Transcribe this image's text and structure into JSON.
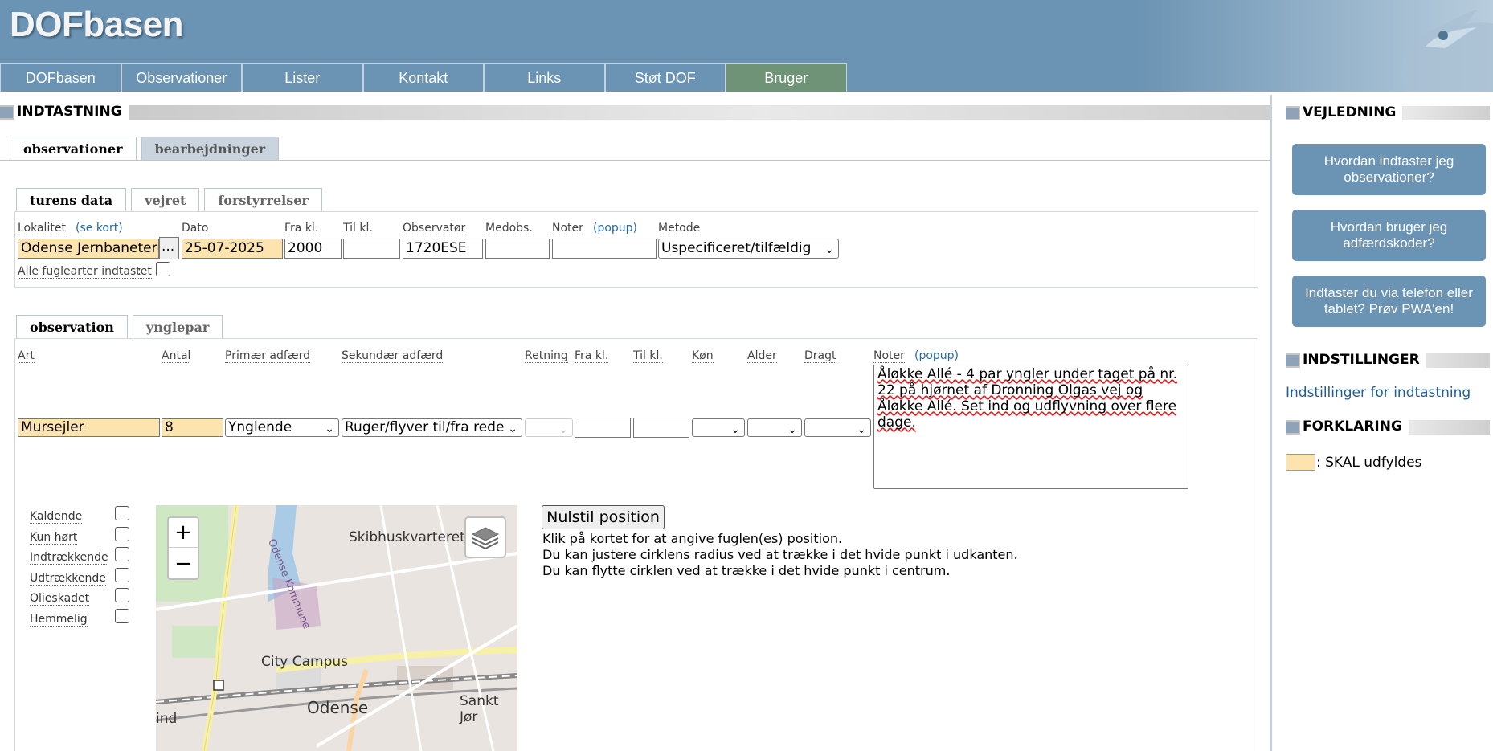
{
  "app": {
    "logo": "DOFbasen"
  },
  "nav": [
    "DOFbasen",
    "Observationer",
    "Lister",
    "Kontakt",
    "Links",
    "Støt DOF",
    "Bruger"
  ],
  "main": {
    "title": "INDTASTNING",
    "tabs": [
      "observationer",
      "bearbejdninger"
    ],
    "trip_tabs": [
      "turens data",
      "vejret",
      "forstyrrelser"
    ],
    "trip": {
      "lokalitet_label": "Lokalitet",
      "lokalitet_link": "(se kort)",
      "lokalitet_value": "Odense Jernbaneterr",
      "dots": "...",
      "dato_label": "Dato",
      "dato_value": "25-07-2025",
      "fra_label": "Fra kl.",
      "fra_value": "2000",
      "til_label": "Til kl.",
      "til_value": "",
      "obs_label": "Observatør",
      "obs_value": "1720ESE",
      "medobs_label": "Medobs.",
      "medobs_value": "",
      "noter_label": "Noter",
      "noter_link": "(popup)",
      "noter_value": "",
      "metode_label": "Metode",
      "metode_value": "Uspecificeret/tilfældig",
      "alle_label": "Alle fuglearter indtastet"
    },
    "obs_tabs": [
      "observation",
      "ynglepar"
    ],
    "obs": {
      "art_label": "Art",
      "art_value": "Mursejler",
      "antal_label": "Antal",
      "antal_value": "8",
      "prim_label": "Primær adfærd",
      "prim_value": "Ynglende",
      "sek_label": "Sekundær adfærd",
      "sek_value": "Ruger/flyver til/fra rede",
      "retning_label": "Retning",
      "fra_label": "Fra kl.",
      "til_label": "Til kl.",
      "kon_label": "Køn",
      "alder_label": "Alder",
      "dragt_label": "Dragt",
      "noter_label": "Noter",
      "noter_link": "(popup)",
      "notes_value": "Åløkke Allé - 4 par yngler under taget på nr. 22 på hjørnet af Dronning Olgas vej og Åløkke Allé. Set ind og udflyvning over flere dage."
    },
    "checks": [
      "Kaldende",
      "Kun hørt",
      "Indtrækkende",
      "Udtrækkende",
      "Olieskadet",
      "Hemmelig"
    ],
    "map": {
      "zoom_in": "+",
      "zoom_out": "−",
      "labels": [
        "Skibhuskvarteret",
        "Odense Kommune",
        "City Campus",
        "Odense",
        "Sankt Jør",
        "ind"
      ]
    },
    "reset_btn": "Nulstil position",
    "info": [
      "Klik på kortet for at angive fuglen(es) position.",
      "Du kan justere cirklens radius ved at trække i det hvide punkt i udkanten.",
      "Du kan flytte cirklen ved at trække i det hvide punkt i centrum."
    ]
  },
  "sidebar": {
    "guide_title": "VEJLEDNING",
    "buttons": [
      "Hvordan indtaster jeg observationer?",
      "Hvordan bruger jeg adfærdskoder?",
      "Indtaster du via telefon eller tablet? Prøv PWA'en!"
    ],
    "settings_title": "INDSTILLINGER",
    "settings_link": "Indstillinger for indtastning",
    "legend_title": "FORKLARING",
    "legend_text": ": SKAL udfyldes"
  },
  "colors": {
    "header": "#6b93b3",
    "nav_active": "#6e9377",
    "required": "#fde3ad",
    "button": "#6b93b3"
  }
}
